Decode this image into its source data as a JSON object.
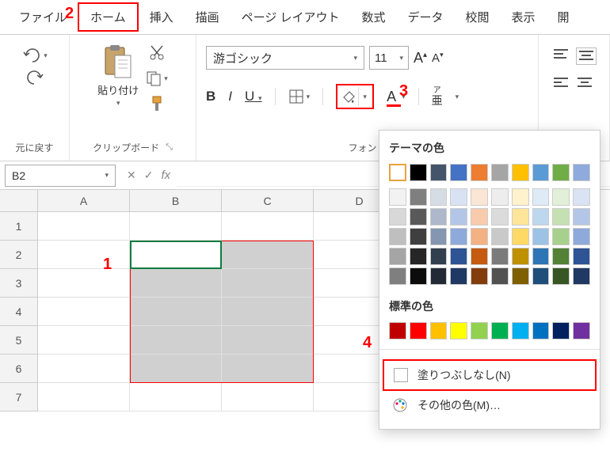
{
  "tabs": {
    "file": "ファイル",
    "home": "ホーム",
    "insert": "挿入",
    "draw": "描画",
    "layout": "ページ レイアウト",
    "formula": "数式",
    "data": "データ",
    "review": "校閲",
    "view": "表示",
    "dev": "開"
  },
  "ribbon": {
    "undo_group": "元に戻す",
    "clipboard_group": "クリップボード",
    "paste": "貼り付け",
    "font_group": "フォント",
    "font_name": "游ゴシック",
    "font_size": "11",
    "bold": "B",
    "italic": "I",
    "underline": "U",
    "fontcolor": "A",
    "ruby_small": "ア",
    "ruby_large": "亜"
  },
  "namebox": "B2",
  "fx": "fx",
  "cols": [
    "A",
    "B",
    "C",
    "D"
  ],
  "rows": [
    "1",
    "2",
    "3",
    "4",
    "5",
    "6",
    "7"
  ],
  "callouts": {
    "c1": "1",
    "c2": "2",
    "c3": "3",
    "c4": "4"
  },
  "colorpop": {
    "theme": "テーマの色",
    "standard": "標準の色",
    "nofill": "塗りつぶしなし(N)",
    "more": "その他の色(M)…",
    "theme_row": [
      "#ffffff",
      "#000000",
      "#44546a",
      "#4472c4",
      "#ed7d31",
      "#a5a5a5",
      "#ffc000",
      "#5b9bd5",
      "#70ad47",
      "#8faadc"
    ],
    "theme_tints": [
      [
        "#f2f2f2",
        "#7f7f7f",
        "#d6dce4",
        "#d9e2f3",
        "#fbe5d5",
        "#ededed",
        "#fff2cc",
        "#deebf6",
        "#e2efd9",
        "#dae3f3"
      ],
      [
        "#d8d8d8",
        "#595959",
        "#adb9ca",
        "#b4c6e7",
        "#f7cbac",
        "#dbdbdb",
        "#fee599",
        "#bdd7ee",
        "#c5e0b3",
        "#b4c6e7"
      ],
      [
        "#bfbfbf",
        "#3f3f3f",
        "#8496b0",
        "#8eaadb",
        "#f4b183",
        "#c9c9c9",
        "#ffd965",
        "#9cc3e5",
        "#a8d08d",
        "#8eaadb"
      ],
      [
        "#a5a5a5",
        "#262626",
        "#323f4f",
        "#2f5496",
        "#c55a11",
        "#7b7b7b",
        "#bf9000",
        "#2e75b5",
        "#538135",
        "#2f5496"
      ],
      [
        "#7f7f7f",
        "#0c0c0c",
        "#222a35",
        "#1f3864",
        "#833c0b",
        "#525252",
        "#7f6000",
        "#1e4e79",
        "#375623",
        "#1f3864"
      ]
    ],
    "standard_row": [
      "#c00000",
      "#ff0000",
      "#ffc000",
      "#ffff00",
      "#92d050",
      "#00b050",
      "#00b0f0",
      "#0070c0",
      "#002060",
      "#7030a0"
    ]
  }
}
